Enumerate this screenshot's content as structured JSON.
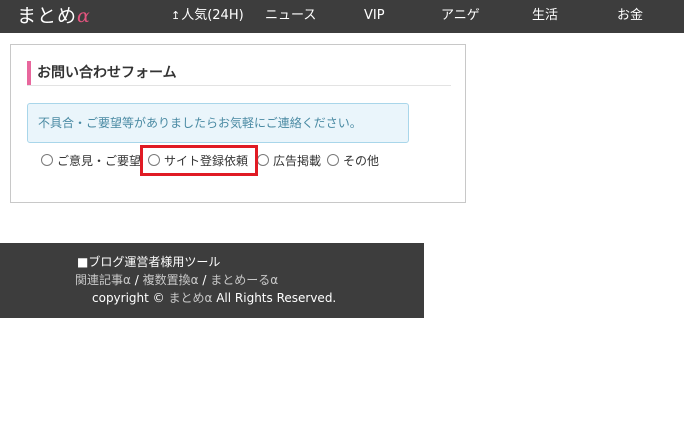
{
  "nav": {
    "logo_text": "まとめ",
    "logo_alpha": "α",
    "items": [
      {
        "icon": "up-arrow-icon",
        "arrow": "↥",
        "label": "人気(24H)"
      },
      {
        "label": "ニュース"
      },
      {
        "label": "VIP"
      },
      {
        "label": "アニゲ"
      },
      {
        "label": "生活"
      },
      {
        "label": "お金"
      }
    ]
  },
  "form": {
    "title": "お問い合わせフォーム",
    "info": "不具合・ご要望等がありましたらお気軽にご連絡ください。",
    "options": [
      "ご意見・ご要望",
      "サイト登録依頼",
      "広告掲載",
      "その他"
    ]
  },
  "footer": {
    "heading": "■ブログ運営者様用ツール",
    "links": [
      "関連記事α",
      "複数置換α",
      "まとめーるα"
    ],
    "separator": " / ",
    "copy_prefix": "copyright © ",
    "copy_site": "まとめα",
    "copy_suffix": " All Rights Reserved."
  },
  "colors": {
    "nav_bg": "#3d3d3d",
    "accent_pink": "#e8679d",
    "info_bg": "#eaf5fb",
    "highlight": "#e01b24"
  }
}
